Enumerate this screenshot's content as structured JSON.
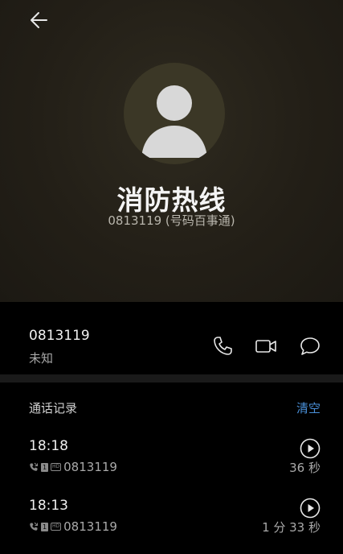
{
  "contact": {
    "name": "消防热线",
    "subtitle": "0813119 (号码百事通)",
    "avatar_icon": "person-silhouette-icon"
  },
  "number_row": {
    "number": "0813119",
    "location": "未知",
    "actions": [
      "phone-icon",
      "video-call-icon",
      "message-icon"
    ]
  },
  "call_log": {
    "title": "通话记录",
    "clear_label": "清空",
    "entries": [
      {
        "time": "18:18",
        "sim": "1",
        "hd": "HD",
        "number": "0813119",
        "duration": "36 秒"
      },
      {
        "time": "18:13",
        "sim": "1",
        "hd": "HD",
        "number": "0813119",
        "duration": "1 分 33 秒"
      }
    ]
  },
  "colors": {
    "header_bg": "#231f17",
    "accent": "#4a90d9",
    "background": "#000000"
  }
}
